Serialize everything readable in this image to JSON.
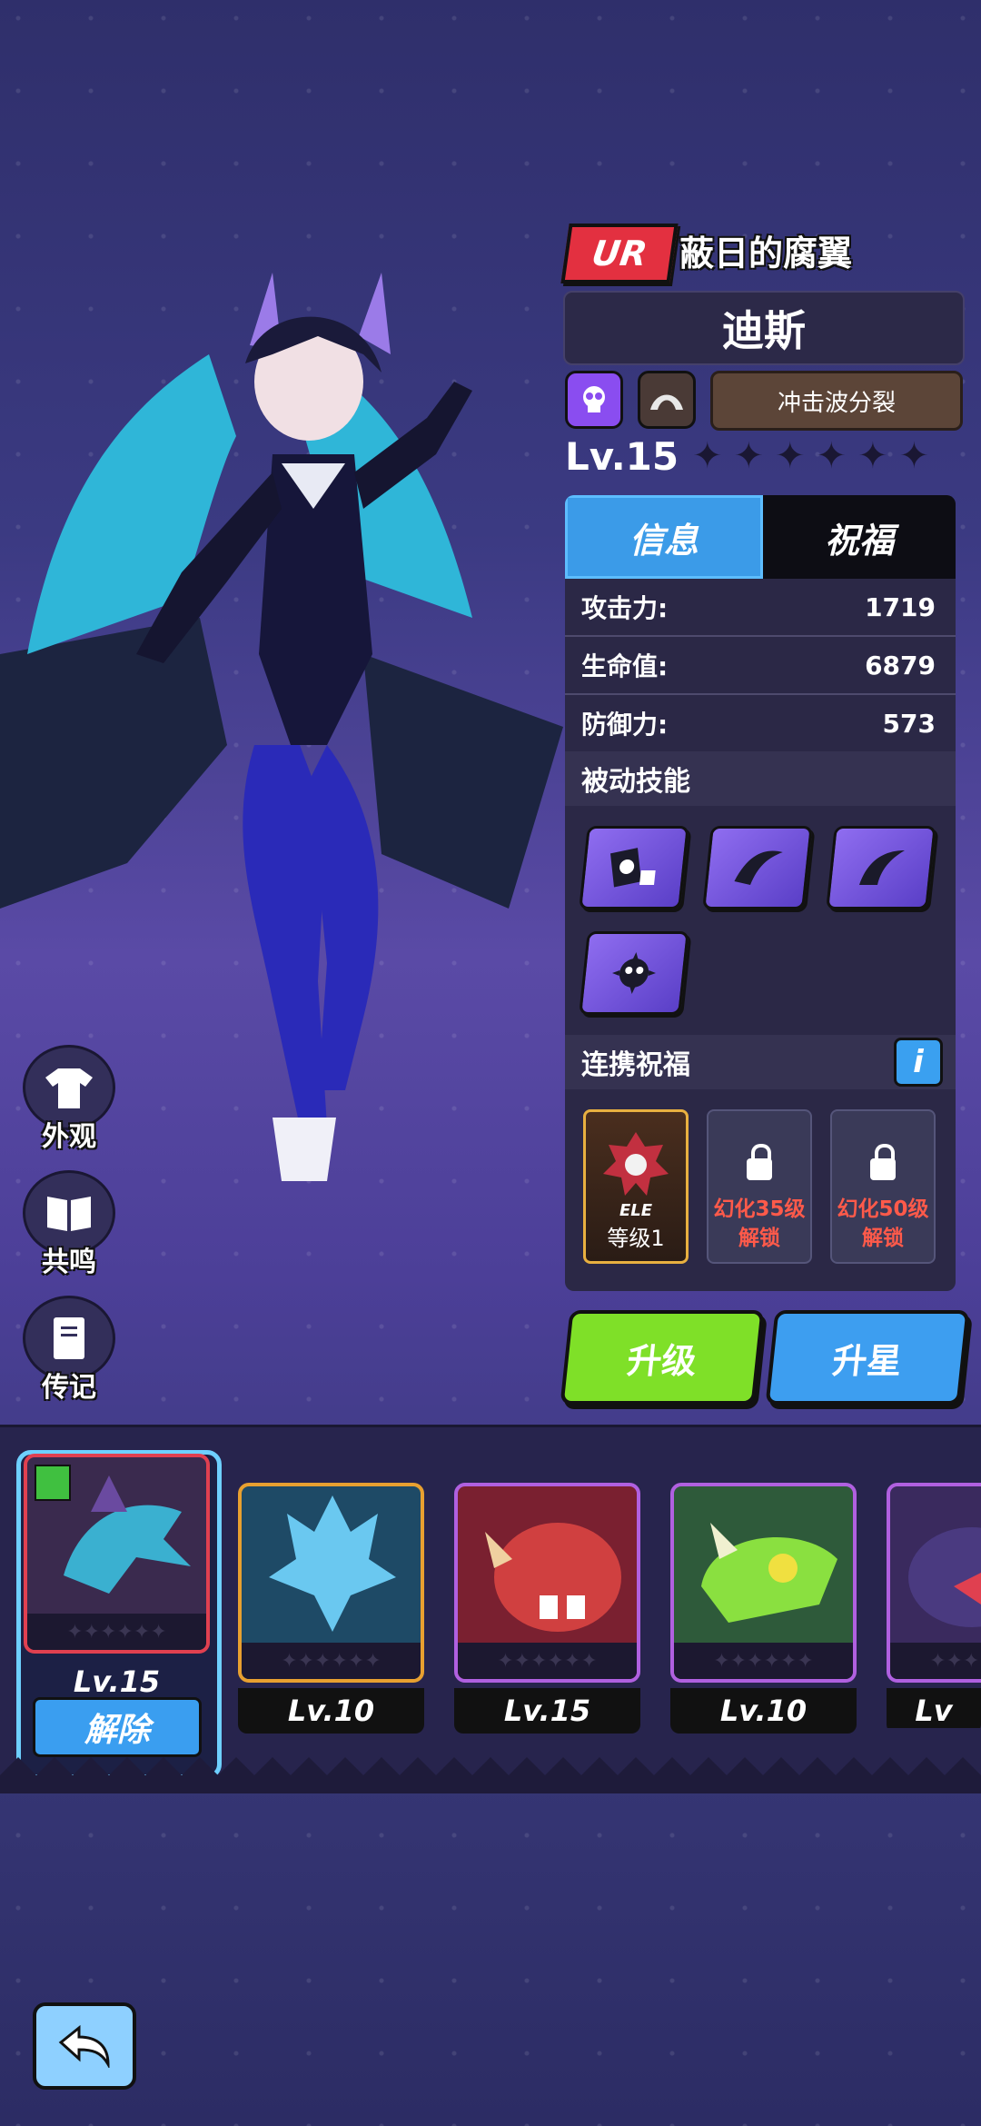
{
  "hero": {
    "rarity": "UR",
    "title": "蔽日的腐翼",
    "name": "迪斯",
    "skill_tag": "冲击波分裂",
    "level": "Lv.15",
    "stars_total": 6,
    "stars_filled": 0
  },
  "tabs": {
    "info": "信息",
    "blessing": "祝福"
  },
  "stats": [
    {
      "label": "攻击力:",
      "value": "1719"
    },
    {
      "label": "生命值:",
      "value": "6879"
    },
    {
      "label": "防御力:",
      "value": "573"
    }
  ],
  "passive": {
    "title": "被动技能",
    "icons": [
      "dice-skull-icon",
      "wing-icon",
      "claw-icon",
      "spike-skull-icon"
    ]
  },
  "linked": {
    "title": "连携祝福",
    "info_label": "i",
    "slots": [
      {
        "badge": "ELE",
        "text": "等级1",
        "locked": false
      },
      {
        "text_line1": "幻化35级",
        "text_line2": "解锁",
        "locked": true
      },
      {
        "text_line1": "幻化50级",
        "text_line2": "解锁",
        "locked": true
      }
    ]
  },
  "buttons": {
    "upgrade": "升级",
    "star_up": "升星"
  },
  "side": {
    "appearance": "外观",
    "resonance": "共鸣",
    "biography": "传记"
  },
  "roster": [
    {
      "level": "Lv.15",
      "border": "#e04050",
      "bg": "#3a2a4e",
      "selected": true
    },
    {
      "level": "Lv.10",
      "border": "#e8a030",
      "bg": "#1e4a66"
    },
    {
      "level": "Lv.15",
      "border": "#b060e0",
      "bg": "#7a2030"
    },
    {
      "level": "Lv.10",
      "border": "#b060e0",
      "bg": "#2e5a3a"
    },
    {
      "level": "Lv",
      "border": "#b060e0",
      "bg": "#3a2a5e"
    }
  ],
  "remove_label": "解除",
  "colors": {
    "accent_blue": "#3b9be8",
    "green": "#7fe028",
    "ur_red": "#e33040"
  }
}
